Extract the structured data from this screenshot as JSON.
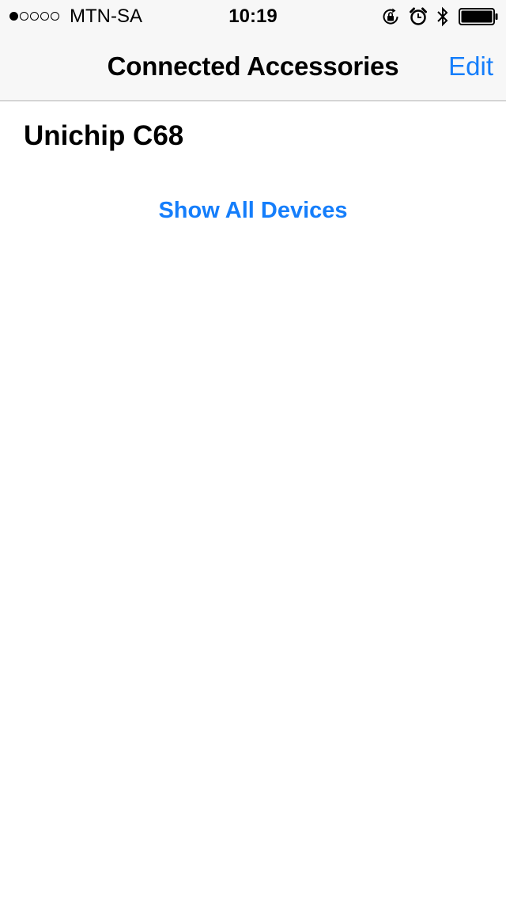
{
  "status_bar": {
    "signal_dots_filled": 1,
    "signal_dots_total": 5,
    "carrier": "MTN-SA",
    "time": "10:19",
    "icons": [
      "rotation-lock-icon",
      "alarm-icon",
      "bluetooth-icon",
      "battery-icon"
    ],
    "battery_level": 1.0
  },
  "nav": {
    "title": "Connected Accessories",
    "edit_label": "Edit"
  },
  "content": {
    "device_name": "Unichip C68",
    "show_all_label": "Show All Devices"
  },
  "colors": {
    "accent": "#157efb",
    "bar_background": "#f7f7f7",
    "separator": "#b2b2b2"
  }
}
